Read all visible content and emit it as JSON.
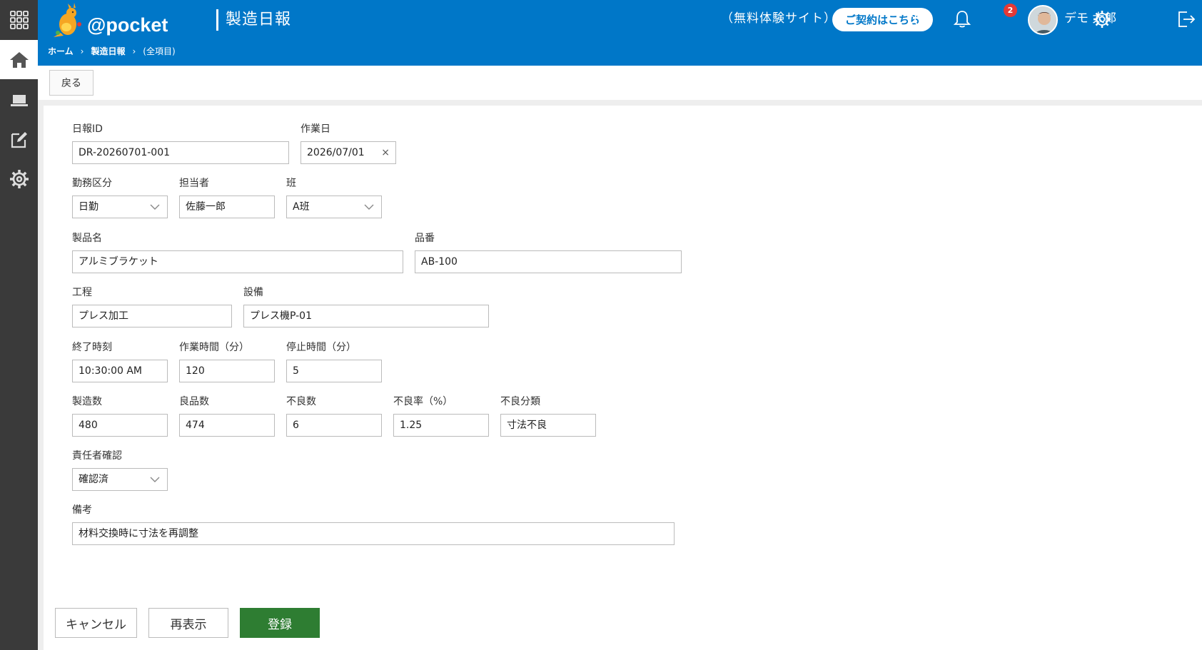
{
  "header": {
    "logo_text": "@pocket",
    "page_title": "製造日報",
    "trial_text": "（無料体験サイト）",
    "contract_button": "ご契約はこちら",
    "notification_count": "2",
    "user_name": "デモ 太郎"
  },
  "breadcrumb": {
    "home": "ホーム",
    "sep1": "›",
    "section": "製造日報",
    "sep2": "›",
    "current": "(全項目)"
  },
  "toolbar": {
    "back_label": "戻る"
  },
  "form": {
    "report_id": {
      "label": "日報ID",
      "value": "DR-20260701-001"
    },
    "work_date": {
      "label": "作業日",
      "value": "2026/07/01",
      "clear": "×"
    },
    "shift_type": {
      "label": "勤務区分",
      "value": "日勤"
    },
    "person": {
      "label": "担当者",
      "value": "佐藤一郎"
    },
    "team": {
      "label": "班",
      "value": "A班"
    },
    "product_name": {
      "label": "製品名",
      "value": "アルミブラケット"
    },
    "part_number": {
      "label": "品番",
      "value": "AB-100"
    },
    "process": {
      "label": "工程",
      "value": "プレス加工"
    },
    "equipment": {
      "label": "設備",
      "value": "プレス機P-01"
    },
    "end_time": {
      "label": "終了時刻",
      "value": "10:30:00 AM"
    },
    "work_minutes": {
      "label": "作業時間（分）",
      "value": "120"
    },
    "stop_minutes": {
      "label": "停止時間（分）",
      "value": "5"
    },
    "produced": {
      "label": "製造数",
      "value": "480"
    },
    "good": {
      "label": "良品数",
      "value": "474"
    },
    "defect": {
      "label": "不良数",
      "value": "6"
    },
    "defect_rate": {
      "label": "不良率（%）",
      "value": "1.25"
    },
    "defect_category": {
      "label": "不良分類",
      "value": "寸法不良"
    },
    "supervisor_check": {
      "label": "責任者確認",
      "value": "確認済"
    },
    "remarks": {
      "label": "備考",
      "value": "材料交換時に寸法を再調整"
    }
  },
  "footer": {
    "cancel": "キャンセル",
    "redisplay": "再表示",
    "register": "登録"
  },
  "colors": {
    "header_blue": "#0077c8",
    "sidebar": "#3a3a3a",
    "register_green": "#2e7d32",
    "badge_red": "#e53935"
  },
  "icons": {
    "apps": "apps-grid-icon",
    "home": "home-icon",
    "laptop": "laptop-icon",
    "edit": "edit-icon",
    "settings": "gear-icon",
    "alert": "alert-icon",
    "bell": "bell-icon",
    "logout": "logout-icon"
  }
}
